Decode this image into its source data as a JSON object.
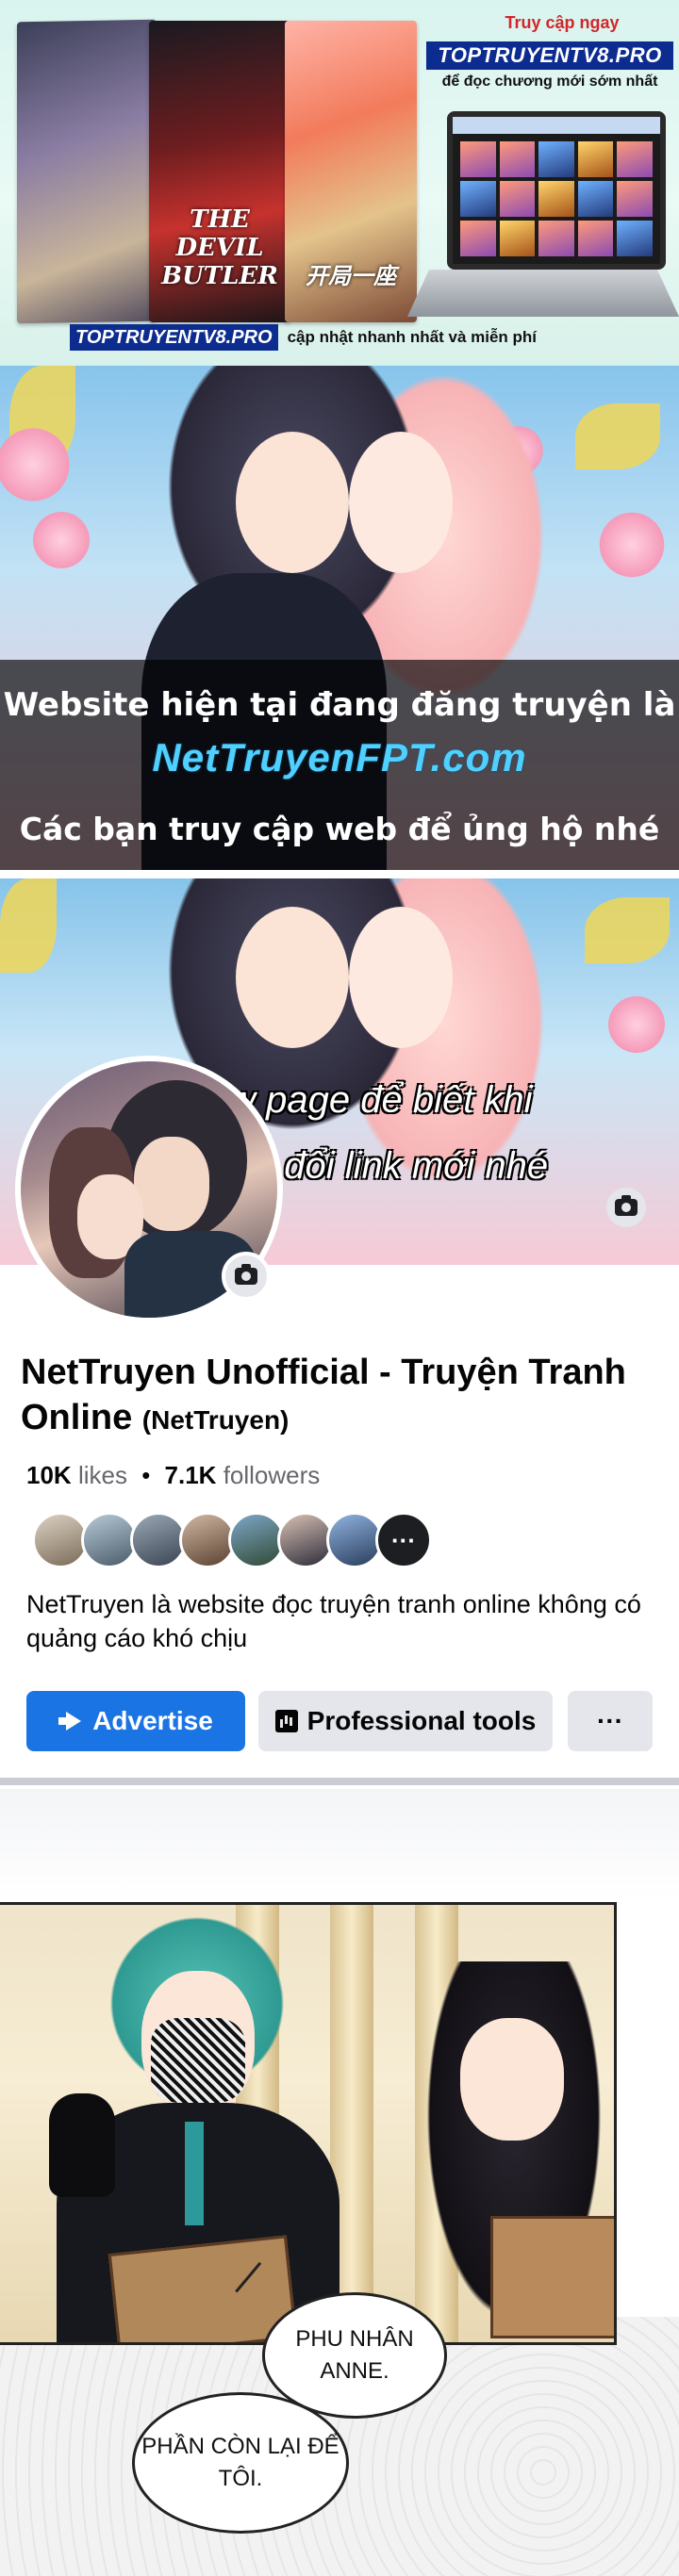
{
  "promo_banner": {
    "headline": "Truy cập ngay",
    "brand": "TOPTRUYENTV8.PRO",
    "subline": "để đọc chương mới sớm nhất",
    "footer_brand": "TOPTRUYENTV8.PRO",
    "footer_tagline": "cập nhật nhanh nhất và miễn phí",
    "cover_titles": [
      "",
      "THE DEVIL BUTLER",
      "开局一座"
    ]
  },
  "notice_banner": {
    "line1": "Website hiện tại đang đăng truyện là",
    "site": "NetTruyenFPT.com",
    "line3": "Các bạn truy cập web để ủng hộ nhé"
  },
  "fb_page": {
    "cover_text_line1": "Follow page để biết khi",
    "cover_text_line2": "nào web đổi link mới nhé",
    "name": "NetTruyen Unofficial - Truyện Tranh Online",
    "handle": "(NetTruyen)",
    "likes_count": "10K",
    "likes_label": "likes",
    "separator": "•",
    "followers_count": "7.1K",
    "followers_label": "followers",
    "more_friends": "···",
    "about": "NetTruyen là website đọc truyện tranh online không có quảng cáo khó chịu",
    "buttons": {
      "advertise": "Advertise",
      "professional_tools": "Professional tools",
      "more": "···"
    },
    "icons": [
      "camera-icon",
      "megaphone-icon",
      "chart-icon",
      "more-icon"
    ],
    "colors": {
      "primary": "#1b74e4",
      "secondary": "#e4e6eb",
      "text": "#050505",
      "muted": "#65676b"
    }
  },
  "manga_panel": {
    "bubble1": "PHU NHÂN ANNE.",
    "bubble2": "PHẦN CÒN LẠI ĐỂ TÔI."
  }
}
